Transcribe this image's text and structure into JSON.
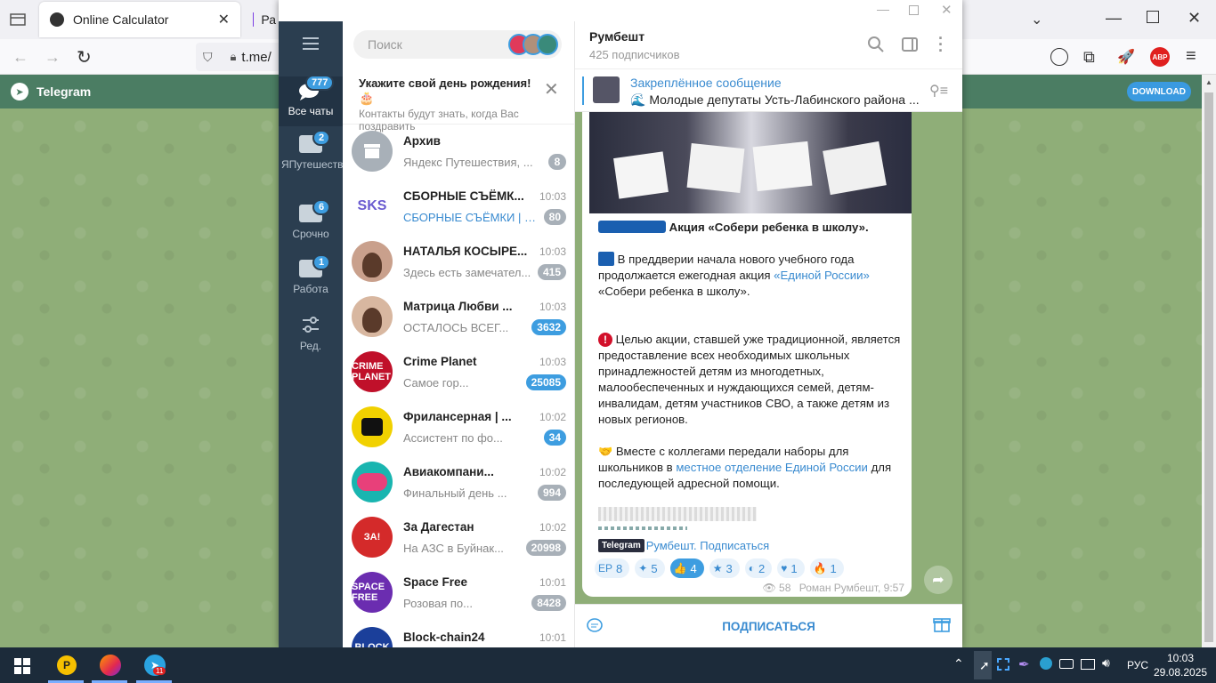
{
  "browser": {
    "tabs": [
      {
        "title": "Online Calculator"
      },
      {
        "title": "Ра"
      }
    ],
    "url": "t.me/"
  },
  "tgheader": {
    "title": "Telegram",
    "download_label": "DOWNLOAD"
  },
  "rail": {
    "items": [
      {
        "label": "Все чаты",
        "badge": "777"
      },
      {
        "label": "ЯПутешествия",
        "badge": "2"
      },
      {
        "label": "Срочно",
        "badge": "6"
      },
      {
        "label": "Работа",
        "badge": "1"
      },
      {
        "label": "Ред.",
        "badge": ""
      }
    ]
  },
  "search": {
    "placeholder": "Поиск"
  },
  "birthday": {
    "title": "Укажите свой день рождения!",
    "emoji": "🎂",
    "subtitle": "Контакты будут знать, когда Вас поздравить"
  },
  "chats": [
    {
      "name": "Архив",
      "time": "",
      "preview": "Яндекс Путешествия, ...",
      "count": "8",
      "avatar": "archive",
      "avatar_color": "#a8b0b8"
    },
    {
      "name": "СБОРНЫЕ СЪЁМК...",
      "time": "10:03",
      "preview": "СБОРНЫЕ СЪЁМКИ | Ф...",
      "count": "80",
      "avatar": "SKS",
      "avatar_color": "#ffffff"
    },
    {
      "name": "НАТАЛЬЯ КОСЫРЕ...",
      "time": "10:03",
      "preview": "Здесь есть замечател...",
      "count": "415",
      "avatar": "photo",
      "avatar_color": "#c9a08c"
    },
    {
      "name": "Матрица Любви ...",
      "time": "10:03",
      "preview": "ОСТАЛОСЬ ВСЕГ...",
      "count": "3632",
      "avatar": "photo",
      "avatar_color": "#d8b7a0"
    },
    {
      "name": "Crime Planet",
      "time": "10:03",
      "preview": "Самое гор...",
      "count": "25085",
      "avatar": "CRIME PLANET",
      "avatar_color": "#c0102a"
    },
    {
      "name": "Фрилансерная | ...",
      "time": "10:02",
      "preview": "Ассистент по фо...",
      "count": "34",
      "avatar": "user",
      "avatar_color": "#f1d100"
    },
    {
      "name": "Авиакомпани...",
      "time": "10:02",
      "preview": "Финальный день ...",
      "count": "994",
      "avatar": "avia",
      "avatar_color": "#19b5b0"
    },
    {
      "name": "За Дагестан",
      "time": "10:02",
      "preview": "На АЗС в Буйнак...",
      "count": "20998",
      "avatar": "ЗА!",
      "avatar_color": "#d42a2a"
    },
    {
      "name": "Space Free",
      "time": "10:01",
      "preview": "Розовая по...",
      "count": "8428",
      "avatar": "SPACE FREE",
      "avatar_color": "#6b2db0"
    },
    {
      "name": "Block-chain24",
      "time": "10:01",
      "preview": "",
      "count": "",
      "avatar": "BLOCK",
      "avatar_color": "#1b3f9a"
    }
  ],
  "channel": {
    "name": "Румбешт",
    "subscribers": "425 подписчиков"
  },
  "pinned": {
    "label": "Закреплённое сообщение",
    "text": "Молодые депутаты Усть-Лабинского района ..."
  },
  "message": {
    "heading": "Акция «Собери ребенка в школу».",
    "p1a": "В преддверии начала нового учебного года продолжается ежегодная акция ",
    "p1link": "«Единой России»",
    "p1b": " «Собери ребенка в школу».",
    "p2": "Целью акции, ставшей уже традиционной, является предоставление всех необходимых школьных принадлежностей детям из многодетных, малообеспеченных и нуждающихся семей, детям-инвалидам, детям участников СВО, а также детям из новых регионов.",
    "p3a": "Вместе с коллегами передали наборы для школьников в ",
    "p3link": "местное отделение Единой России",
    "p3b": " для последующей адресной помощи.",
    "tg_badge": "Telegram",
    "subscribe_link": "Румбешт. Подписаться",
    "reactions": [
      {
        "emoji": "ЕР",
        "count": "8"
      },
      {
        "emoji": "✦",
        "count": "5"
      },
      {
        "emoji": "👍",
        "count": "4"
      },
      {
        "emoji": "★",
        "count": "3"
      },
      {
        "emoji": "◐",
        "count": "2"
      },
      {
        "emoji": "♥",
        "count": "1"
      },
      {
        "emoji": "🔥",
        "count": "1"
      }
    ],
    "views": "58",
    "author_time": "Роман Румбешт, 9:57"
  },
  "footer": {
    "subscribe_label": "ПОДПИСАТЬСЯ"
  },
  "taskbar": {
    "lang": "РУС",
    "time": "10:03",
    "date": "29.08.2025",
    "telegram_badge": "11"
  }
}
